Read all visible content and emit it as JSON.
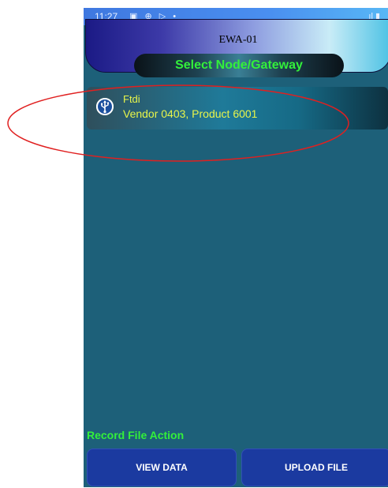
{
  "status_bar": {
    "time": "11:27",
    "icons": "▣ ⊕ ▷ •",
    "right": "ıl ▮"
  },
  "header": {
    "title": "EWA-01"
  },
  "section": {
    "title": "Select Node/Gateway"
  },
  "devices": [
    {
      "name": "Ftdi",
      "detail": "Vendor 0403, Product 6001",
      "icon": "usb-icon"
    }
  ],
  "record": {
    "label": "Record File Action",
    "view_button": "VIEW DATA",
    "upload_button": "UPLOAD FILE"
  },
  "colors": {
    "background": "#1d6079",
    "accent_green": "#33f03a",
    "device_text": "#e8f54a",
    "button": "#1b3aa0",
    "annotation": "#e02020"
  }
}
